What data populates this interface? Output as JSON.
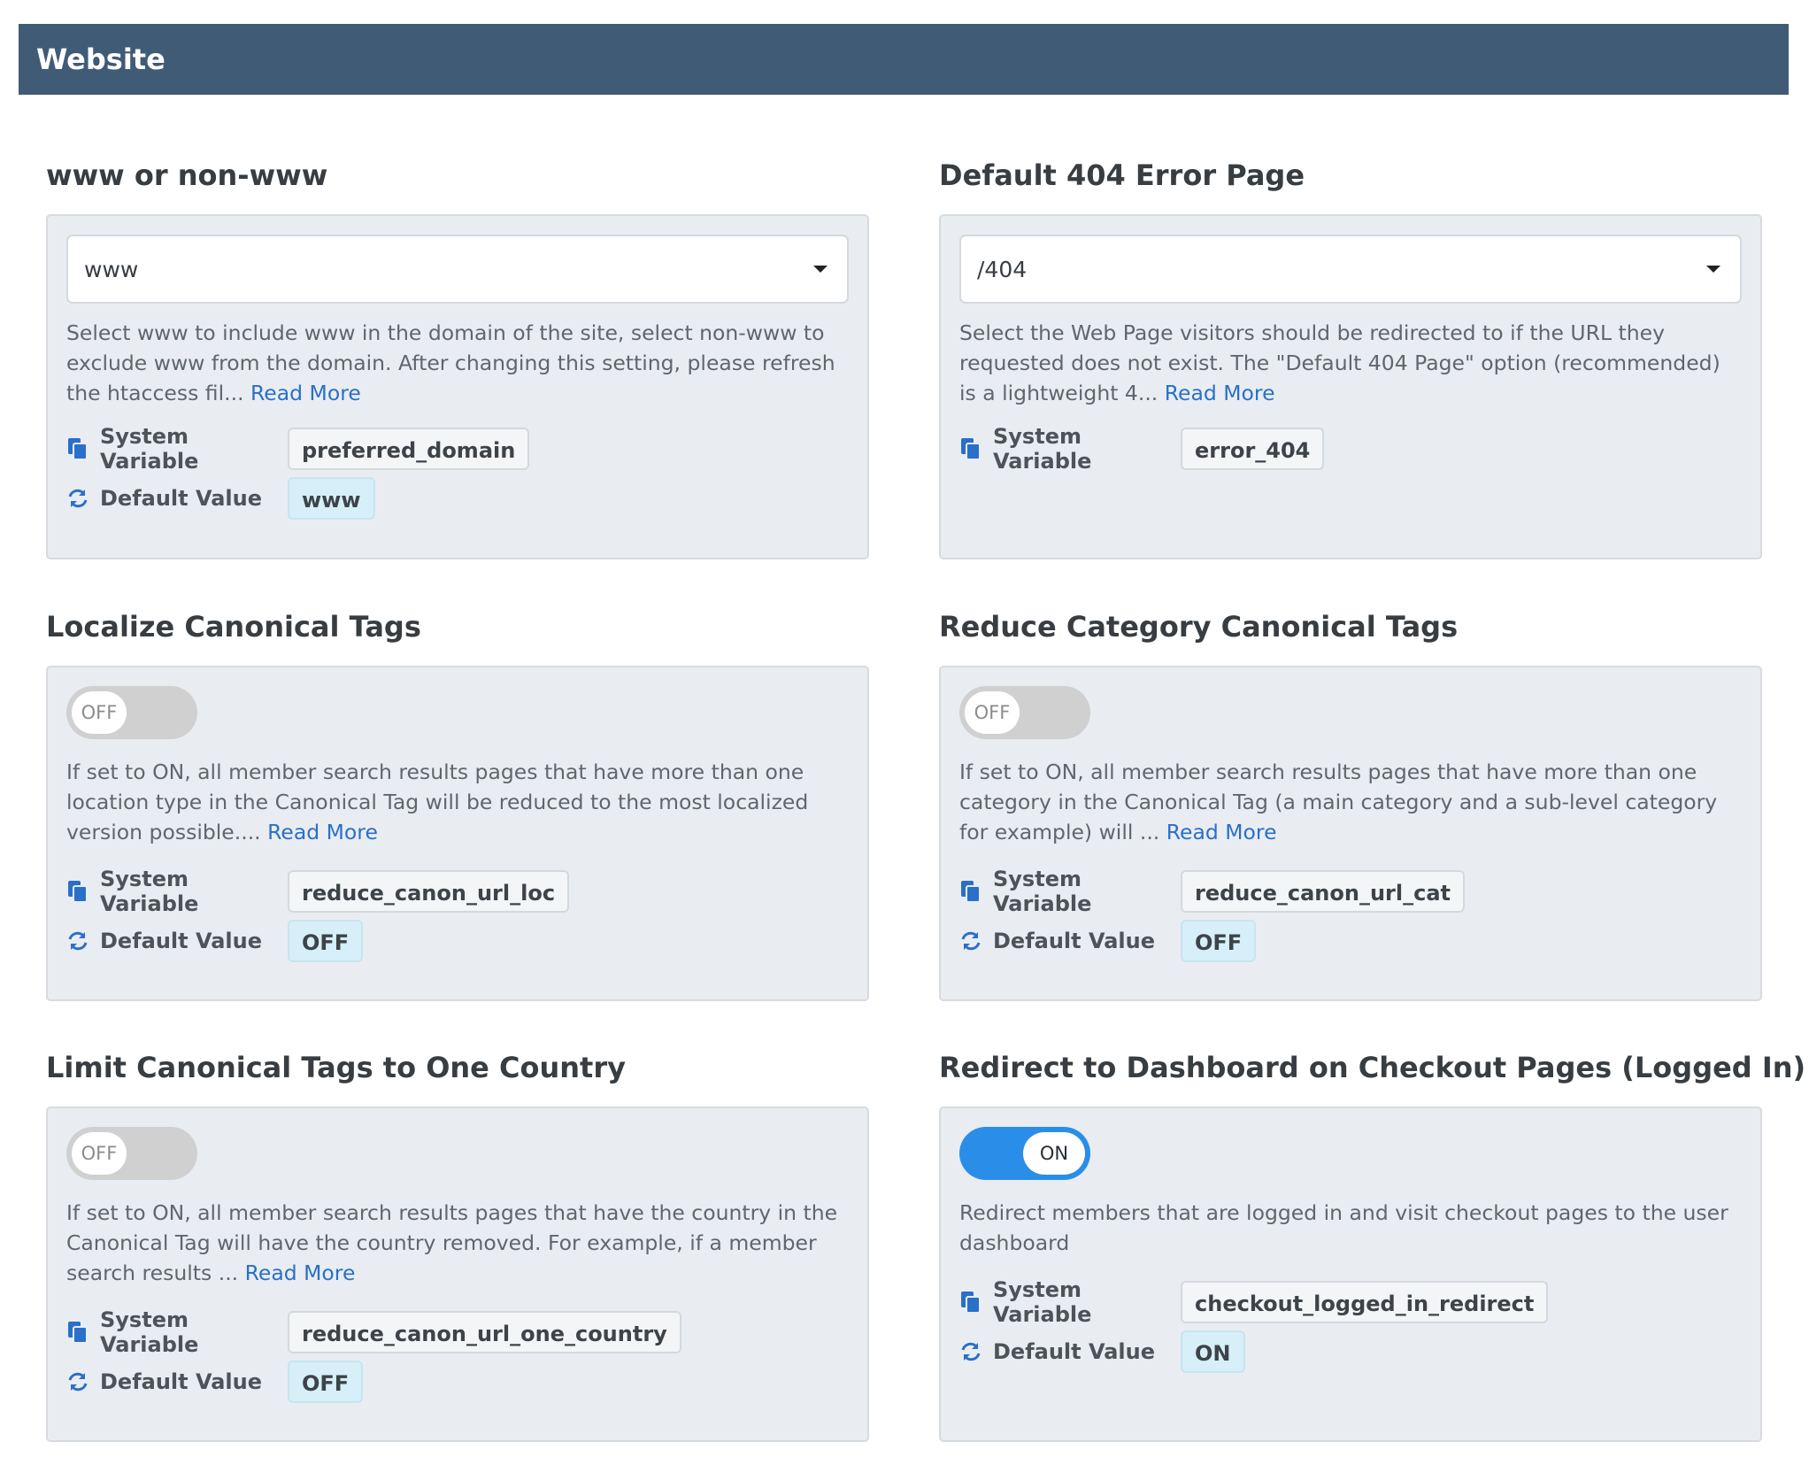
{
  "header": {
    "title": "Website"
  },
  "labels": {
    "system_variable": "System Variable",
    "default_value": "Default Value"
  },
  "settings": [
    {
      "title": "www or non-www",
      "control": "select",
      "select_value": "www",
      "description": "Select www to include www in the domain of the site, select non-www to exclude www from the domain. After changing this setting, please refresh the htaccess fil...",
      "read_more": "Read More",
      "system_variable": "preferred_domain",
      "default_value": "www"
    },
    {
      "title": "Default 404 Error Page",
      "control": "select",
      "select_value": "/404",
      "description": "Select the Web Page visitors should be redirected to if the URL they requested does not exist.  The \"Default 404 Page\" option (recommended) is a lightweight 4...",
      "read_more": "Read More",
      "system_variable": "error_404"
    },
    {
      "title": "Localize Canonical Tags",
      "control": "toggle",
      "toggle_state": "OFF",
      "description": "If set to ON, all member search results pages that have more than one location type in the Canonical Tag will be reduced to the most localized version possible....",
      "read_more": "Read More",
      "system_variable": "reduce_canon_url_loc",
      "default_value": "OFF"
    },
    {
      "title": "Reduce Category Canonical Tags",
      "control": "toggle",
      "toggle_state": "OFF",
      "description": "If set to ON, all member search results pages that have more than one category in the Canonical Tag (a main category and a sub-level category for example) will ...",
      "read_more": "Read More",
      "system_variable": "reduce_canon_url_cat",
      "default_value": "OFF"
    },
    {
      "title": "Limit Canonical Tags to One Country",
      "control": "toggle",
      "toggle_state": "OFF",
      "description": "If set to ON, all member search results pages that have the country in the Canonical Tag will have the country removed. For example, if a member search results ...",
      "read_more": "Read More",
      "system_variable": "reduce_canon_url_one_country",
      "default_value": "OFF"
    },
    {
      "title": "Redirect to Dashboard on Checkout Pages (Logged In)",
      "control": "toggle",
      "toggle_state": "ON",
      "description": "Redirect members that are logged in and visit checkout pages to the user dashboard",
      "system_variable": "checkout_logged_in_redirect",
      "default_value": "ON"
    }
  ],
  "icons": {
    "system_variable": "copy-icon",
    "default_value": "refresh-icon",
    "select": "caret-down-icon"
  },
  "colors": {
    "header_bg": "#405b76",
    "panel_bg": "#e9edf1",
    "link": "#2a6fc9",
    "toggle_on": "#2a8ee8",
    "toggle_off": "#d0d0d0",
    "default_chip_bg": "#d6eff8"
  }
}
